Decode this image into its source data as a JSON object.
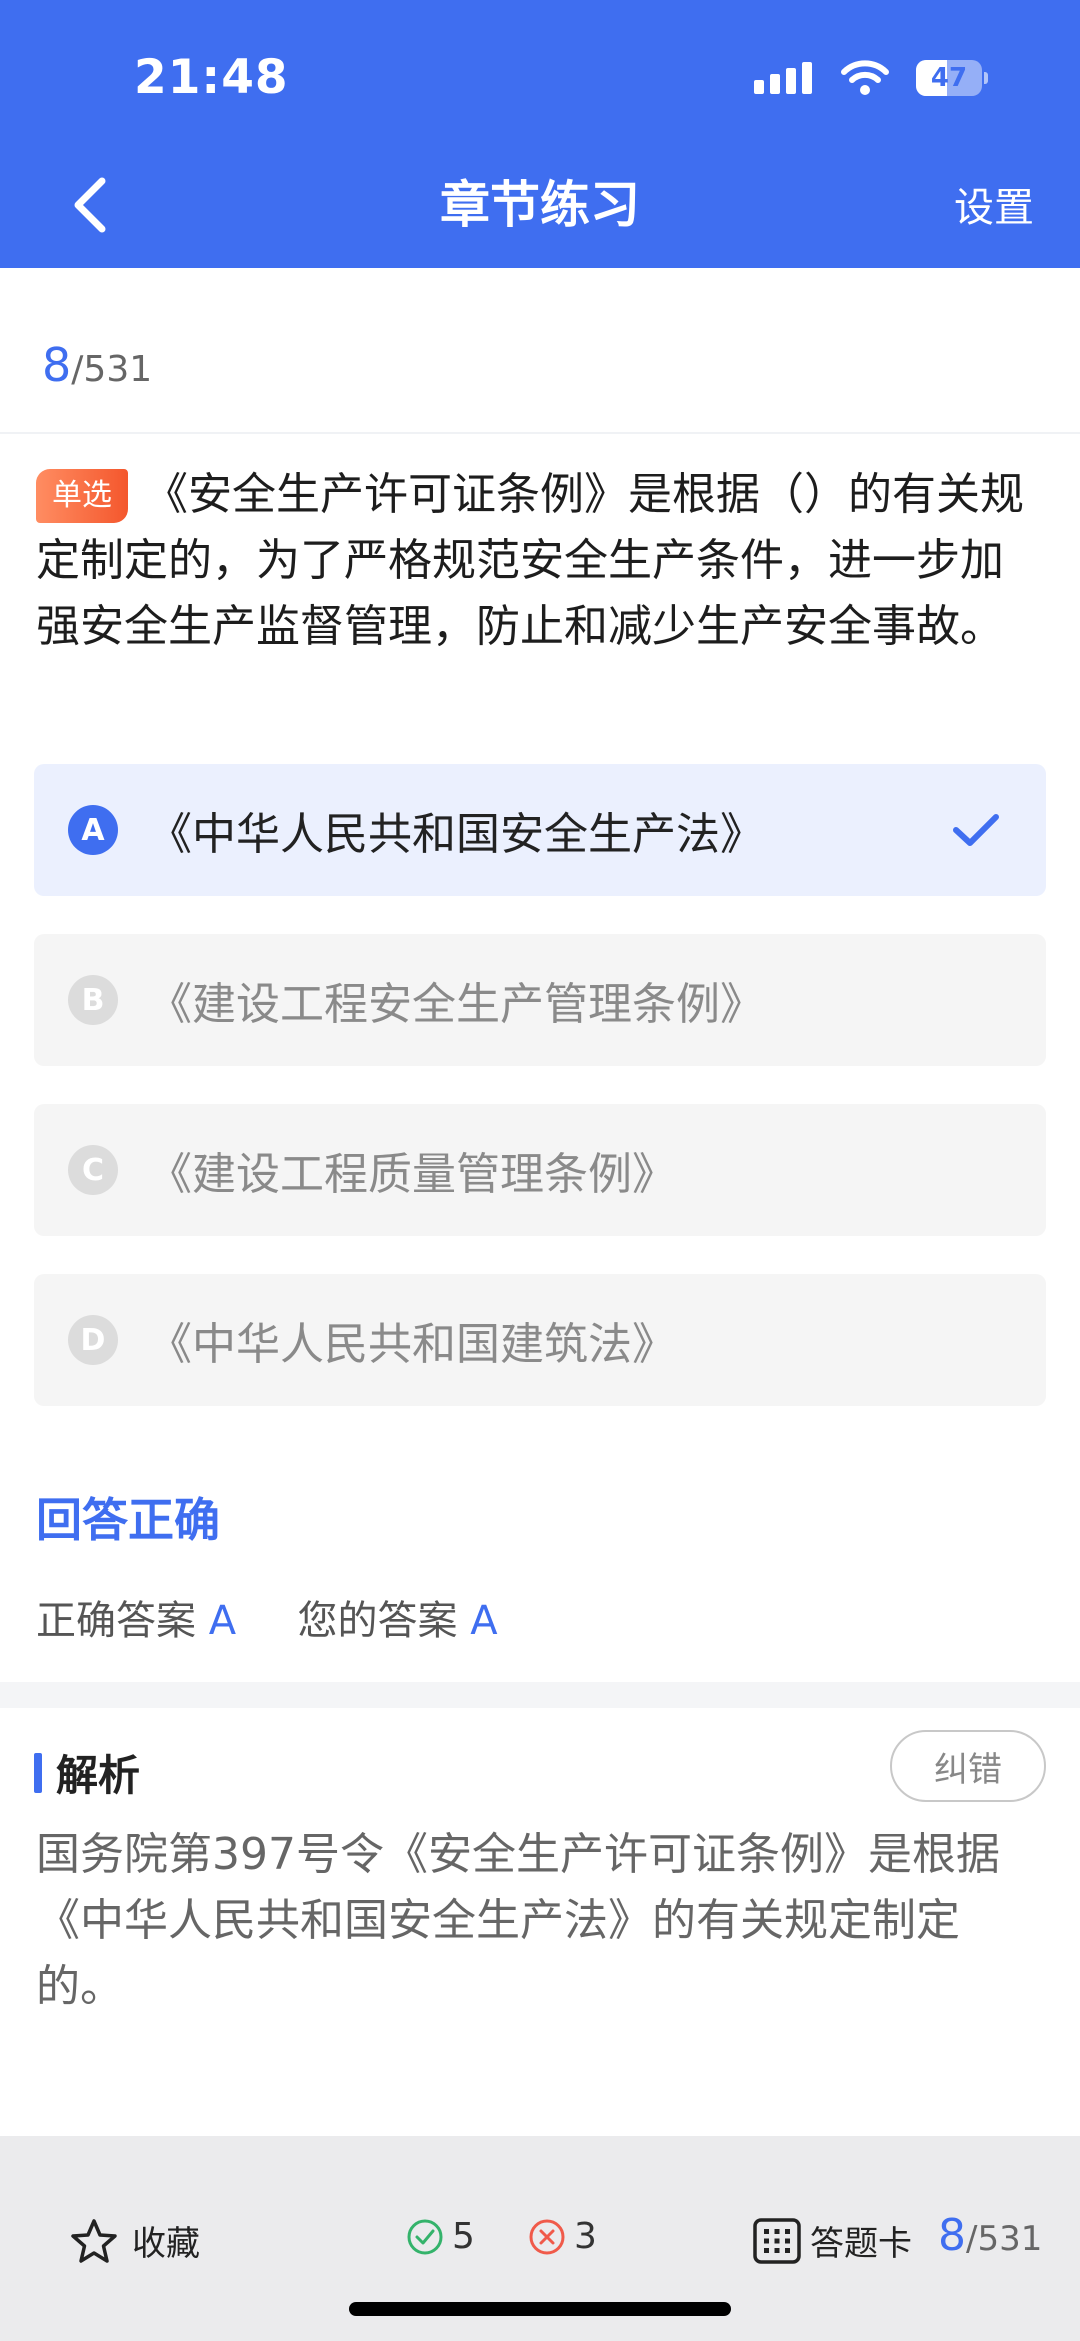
{
  "status_bar": {
    "time": "21:48",
    "battery": "47",
    "battery_level": 0.47
  },
  "nav": {
    "title": "章节练习",
    "settings_label": "设置"
  },
  "progress": {
    "current": "8",
    "total": "/531"
  },
  "question": {
    "type_badge": "单选",
    "text": "《安全生产许可证条例》是根据（）的有关规定制定的，为了严格规范安全生产条件，进一步加强安全生产监督管理，防止和减少生产安全事故。"
  },
  "options": [
    {
      "letter": "A",
      "text": "《中华人民共和国安全生产法》",
      "selected": true
    },
    {
      "letter": "B",
      "text": "《建设工程安全生产管理条例》",
      "selected": false
    },
    {
      "letter": "C",
      "text": "《建设工程质量管理条例》",
      "selected": false
    },
    {
      "letter": "D",
      "text": "《中华人民共和国建筑法》",
      "selected": false
    }
  ],
  "result": {
    "title": "回答正确",
    "correct_label": "正确答案",
    "correct_value": "A",
    "your_label": "您的答案",
    "your_value": "A"
  },
  "analysis": {
    "title": "解析",
    "report_button": "纠错",
    "text": "国务院第397号令《安全生产许可证条例》是根据《中华人民共和国安全生产法》的有关规定制定的。"
  },
  "bottom_bar": {
    "favorite_label": "收藏",
    "correct_count": "5",
    "wrong_count": "3",
    "answer_card_label": "答题卡",
    "current": "8",
    "total": "/531"
  },
  "colors": {
    "primary": "#3f6ef0",
    "badge": "#f4572d",
    "correct": "#34b36b",
    "wrong": "#f05a4a"
  },
  "icons": [
    "back-chevron-icon",
    "signal-icon",
    "wifi-icon",
    "battery-icon",
    "checkmark-icon",
    "star-icon",
    "check-circle-icon",
    "x-circle-icon",
    "grid-icon"
  ]
}
